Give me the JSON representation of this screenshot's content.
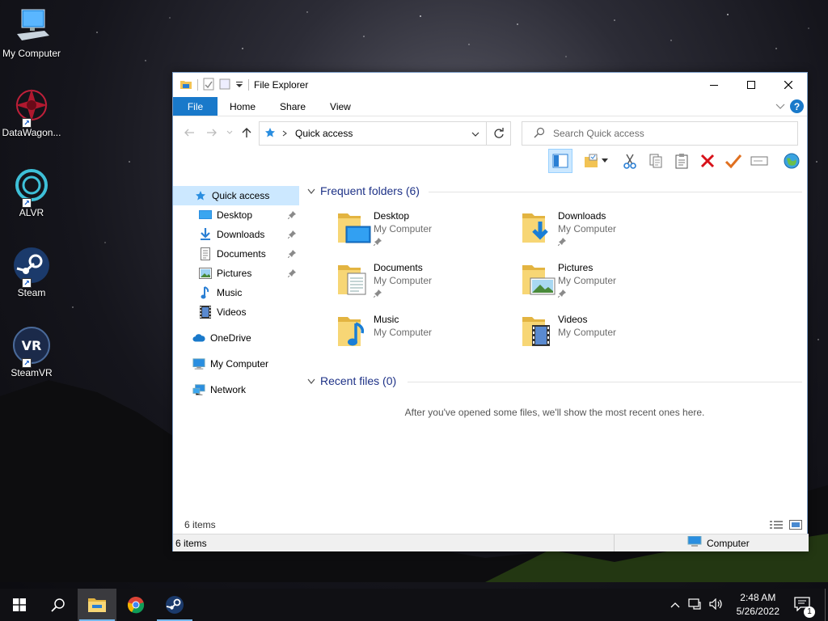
{
  "desktop": {
    "icons": [
      {
        "label": "My Computer"
      },
      {
        "label": "DataWagon..."
      },
      {
        "label": "ALVR"
      },
      {
        "label": "Steam"
      },
      {
        "label": "SteamVR"
      }
    ]
  },
  "window": {
    "title": "File Explorer",
    "ribbon_tabs": [
      "File",
      "Home",
      "Share",
      "View"
    ],
    "address": {
      "crumb": "Quick access"
    },
    "search": {
      "placeholder": "Search Quick access"
    },
    "sidebar": [
      {
        "label": "Quick access",
        "icon": "star-icon",
        "selected": true
      },
      {
        "label": "Desktop",
        "icon": "desktop-icon",
        "pinned": true
      },
      {
        "label": "Downloads",
        "icon": "download-icon",
        "pinned": true
      },
      {
        "label": "Documents",
        "icon": "document-icon",
        "pinned": true
      },
      {
        "label": "Pictures",
        "icon": "picture-icon",
        "pinned": true
      },
      {
        "label": "Music",
        "icon": "music-icon"
      },
      {
        "label": "Videos",
        "icon": "video-icon"
      },
      {
        "label": "OneDrive",
        "icon": "cloud-icon"
      },
      {
        "label": "My Computer",
        "icon": "computer-icon"
      },
      {
        "label": "Network",
        "icon": "network-icon"
      }
    ],
    "frequent": {
      "header": "Frequent folders (6)",
      "folders": [
        {
          "name": "Desktop",
          "location": "My Computer",
          "pinned": true
        },
        {
          "name": "Downloads",
          "location": "My Computer",
          "pinned": true
        },
        {
          "name": "Documents",
          "location": "My Computer",
          "pinned": true
        },
        {
          "name": "Pictures",
          "location": "My Computer",
          "pinned": true
        },
        {
          "name": "Music",
          "location": "My Computer"
        },
        {
          "name": "Videos",
          "location": "My Computer"
        }
      ]
    },
    "recent": {
      "header": "Recent files (0)",
      "empty_message": "After you've opened some files, we'll show the most recent ones here."
    },
    "status": {
      "items_top": "6 items",
      "items_bottom": "6 items",
      "location": "Computer"
    }
  },
  "taskbar": {
    "time": "2:48 AM",
    "date": "5/26/2022",
    "notification_count": "1"
  },
  "colors": {
    "accent": "#1979ca",
    "selected": "#cce8ff",
    "section_header": "#1e3287",
    "delete_red": "#d8121a",
    "check_orange": "#e07020"
  }
}
